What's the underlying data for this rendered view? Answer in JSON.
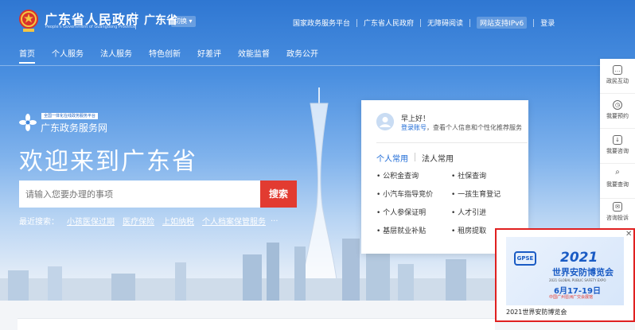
{
  "header": {
    "site_name": "广东省人民政府",
    "site_name_en": "People's Government of Guangdong Province",
    "region": "广东省",
    "switch_label": "切换",
    "links": [
      "国家政务服务平台",
      "广东省人民政府",
      "无障碍阅读",
      "网站支持IPv6",
      "登录"
    ]
  },
  "nav": {
    "items": [
      "首页",
      "个人服务",
      "法人服务",
      "特色创新",
      "好差评",
      "效能监督",
      "政务公开"
    ]
  },
  "hero": {
    "service_subtitle": "全国一体化在线政务服务平台",
    "service_name": "广东政务服务网",
    "welcome": "欢迎来到广东省",
    "search_placeholder": "请输入您要办理的事项",
    "search_button": "搜索",
    "hot_label": "最近搜索：",
    "hot_items": [
      "小孩医保过期",
      "医疗保险",
      "上如纳税",
      "个人档案保管服务"
    ],
    "hot_more": "..."
  },
  "login_card": {
    "greeting": "早上好！",
    "login_link": "登录账号",
    "login_hint": "，查看个人信息和个性化推荐服务",
    "tabs": [
      "个人常用",
      "法人常用"
    ],
    "items": [
      "公积金查询",
      "社保查询",
      "小汽车指导竞价",
      "一孩生育登记",
      "个人参保证明",
      "人才引进",
      "基层就业补贴",
      "租房提取"
    ]
  },
  "tools": [
    "政民互动",
    "我要预约",
    "我要咨询",
    "我要查询",
    "咨询投诉"
  ],
  "ad": {
    "logo": "GPSE",
    "year": "2021",
    "title": "世界安防博览会",
    "subtitle_en": "2021 GLOBAL PUBLIC SAFETY EXPO",
    "date": "6月17-19日",
    "venue": "中国广州琶洲广交会展馆",
    "caption": "2021世界安防博览会"
  }
}
